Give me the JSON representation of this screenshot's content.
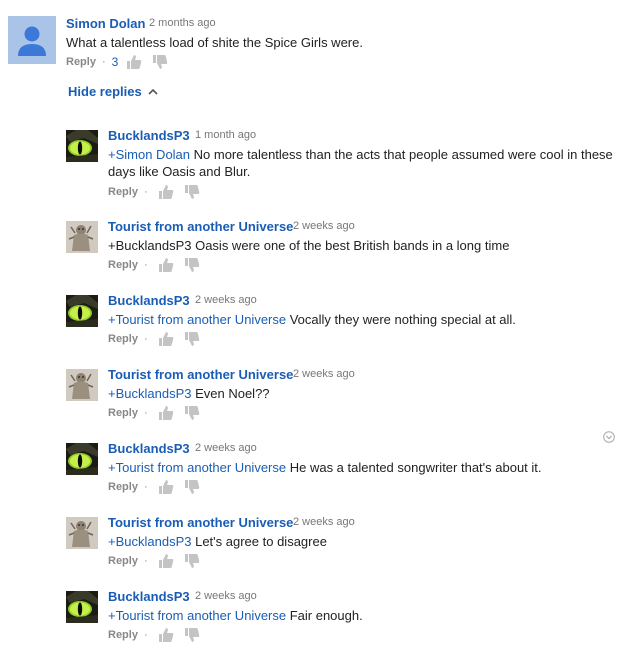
{
  "parent": {
    "author": "Simon Dolan",
    "time": "2 months ago",
    "text": "What a talentless load of shite the Spice Girls were.",
    "reply_label": "Reply",
    "like_count": "3",
    "avatar": "default-user-avatar"
  },
  "hide_replies_label": "Hide replies",
  "replies": [
    {
      "author": "BucklandsP3",
      "time": "1 month ago",
      "mention": "+Simon Dolan",
      "text": " No more talentless than the acts that people assumed were cool in these days like Oasis and Blur.",
      "reply_label": "Reply",
      "avatar": "cat-eye-avatar"
    },
    {
      "author": "Tourist from another Universe",
      "time": "2 weeks ago",
      "mention": "",
      "text": "+BucklandsP3 Oasis were one of the best British bands in a long time",
      "reply_label": "Reply",
      "avatar": "statue-avatar"
    },
    {
      "author": "BucklandsP3",
      "time": "2 weeks ago",
      "mention": "+Tourist from another Universe",
      "text": " Vocally they were nothing special at all.",
      "reply_label": "Reply",
      "avatar": "cat-eye-avatar"
    },
    {
      "author": "Tourist from another Universe",
      "time": "2 weeks ago",
      "mention": "+BucklandsP3",
      "text": " Even Noel??",
      "reply_label": "Reply",
      "avatar": "statue-avatar"
    },
    {
      "author": "BucklandsP3",
      "time": "2 weeks ago",
      "mention": "+Tourist from another Universe",
      "text": " He was a talented songwriter that's about it.",
      "reply_label": "Reply",
      "avatar": "cat-eye-avatar"
    },
    {
      "author": "Tourist from another Universe",
      "time": "2 weeks ago",
      "mention": "+BucklandsP3",
      "text": " Let's agree to disagree",
      "reply_label": "Reply",
      "avatar": "statue-avatar"
    },
    {
      "author": "BucklandsP3",
      "time": "2 weeks ago",
      "mention": "+Tourist from another Universe",
      "text": " Fair enough.",
      "reply_label": "Reply",
      "avatar": "cat-eye-avatar"
    }
  ],
  "colors": {
    "link": "#1a5db4",
    "meta": "#777777",
    "text": "#222222",
    "avatar_bg": "#aac4e8",
    "avatar_fg": "#3b78d8"
  }
}
